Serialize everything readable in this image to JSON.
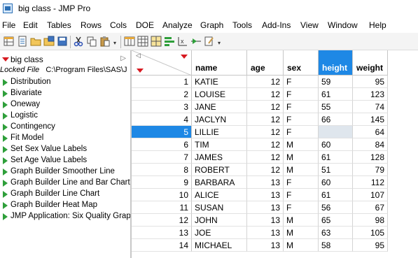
{
  "window": {
    "title": "big class - JMP Pro"
  },
  "menu": [
    "File",
    "Edit",
    "Tables",
    "Rows",
    "Cols",
    "DOE",
    "Analyze",
    "Graph",
    "Tools",
    "Add-Ins",
    "View",
    "Window",
    "Help"
  ],
  "toolbar": {
    "icons": [
      "new-table-icon",
      "new-script-icon",
      "open-icon",
      "save-icon",
      "cut-icon",
      "copy-icon",
      "paste-icon",
      "data-table-icon",
      "data-grid-icon",
      "tabulate-icon",
      "bar-chart-icon",
      "fit-model-icon",
      "regression-icon",
      "script-editor-icon"
    ]
  },
  "left_panel": {
    "table_name": "big class",
    "locked_label": "Locked File",
    "locked_path": "C:\\Program Files\\SAS\\J",
    "scripts": [
      "Distribution",
      "Bivariate",
      "Oneway",
      "Logistic",
      "Contingency",
      "Fit Model",
      "Set Sex Value Labels",
      "Set Age Value Labels",
      "Graph Builder Smoother Line",
      "Graph Builder Line and Bar Chart",
      "Graph Builder Line Chart",
      "Graph Builder Heat Map",
      "JMP Application: Six Quality Graphs"
    ]
  },
  "grid": {
    "columns": [
      "name",
      "age",
      "sex",
      "height",
      "weight"
    ],
    "selected_column": "height",
    "selected_row": 5,
    "rows": [
      {
        "n": "1",
        "name": "KATIE",
        "age": "12",
        "sex": "F",
        "height": "59",
        "weight": "95"
      },
      {
        "n": "2",
        "name": "LOUISE",
        "age": "12",
        "sex": "F",
        "height": "61",
        "weight": "123"
      },
      {
        "n": "3",
        "name": "JANE",
        "age": "12",
        "sex": "F",
        "height": "55",
        "weight": "74"
      },
      {
        "n": "4",
        "name": "JACLYN",
        "age": "12",
        "sex": "F",
        "height": "66",
        "weight": "145"
      },
      {
        "n": "5",
        "name": "LILLIE",
        "age": "12",
        "sex": "F",
        "height": "",
        "weight": "64"
      },
      {
        "n": "6",
        "name": "TIM",
        "age": "12",
        "sex": "M",
        "height": "60",
        "weight": "84"
      },
      {
        "n": "7",
        "name": "JAMES",
        "age": "12",
        "sex": "M",
        "height": "61",
        "weight": "128"
      },
      {
        "n": "8",
        "name": "ROBERT",
        "age": "12",
        "sex": "M",
        "height": "51",
        "weight": "79"
      },
      {
        "n": "9",
        "name": "BARBARA",
        "age": "13",
        "sex": "F",
        "height": "60",
        "weight": "112"
      },
      {
        "n": "10",
        "name": "ALICE",
        "age": "13",
        "sex": "F",
        "height": "61",
        "weight": "107"
      },
      {
        "n": "11",
        "name": "SUSAN",
        "age": "13",
        "sex": "F",
        "height": "56",
        "weight": "67"
      },
      {
        "n": "12",
        "name": "JOHN",
        "age": "13",
        "sex": "M",
        "height": "65",
        "weight": "98"
      },
      {
        "n": "13",
        "name": "JOE",
        "age": "13",
        "sex": "M",
        "height": "63",
        "weight": "105"
      },
      {
        "n": "14",
        "name": "MICHAEL",
        "age": "13",
        "sex": "M",
        "height": "58",
        "weight": "95"
      }
    ]
  },
  "colors": {
    "selection": "#1e88e5",
    "script_icon": "#2e9f3a",
    "red_triangle": "#d71920"
  }
}
